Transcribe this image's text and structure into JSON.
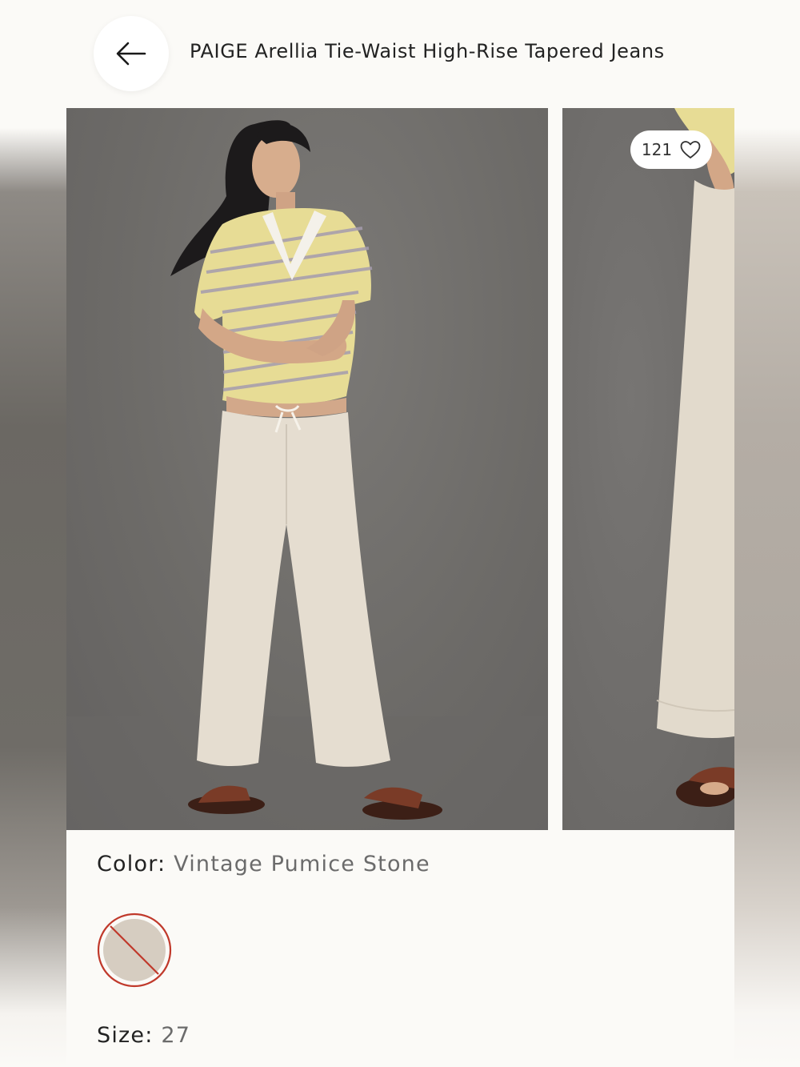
{
  "header": {
    "back_icon": "arrow-left-icon",
    "title": "PAIGE Arellia Tie-Waist High-Rise Tapered Jeans"
  },
  "gallery": {
    "like_count": "121",
    "like_icon": "heart-outline-icon"
  },
  "color": {
    "label": "Color:",
    "value": "Vintage Pumice Stone",
    "swatch_color": "#d6cdc1",
    "swatch_state": "unavailable",
    "swatch_ring_color": "#c0392b"
  },
  "size": {
    "label": "Size:",
    "value": "27"
  }
}
